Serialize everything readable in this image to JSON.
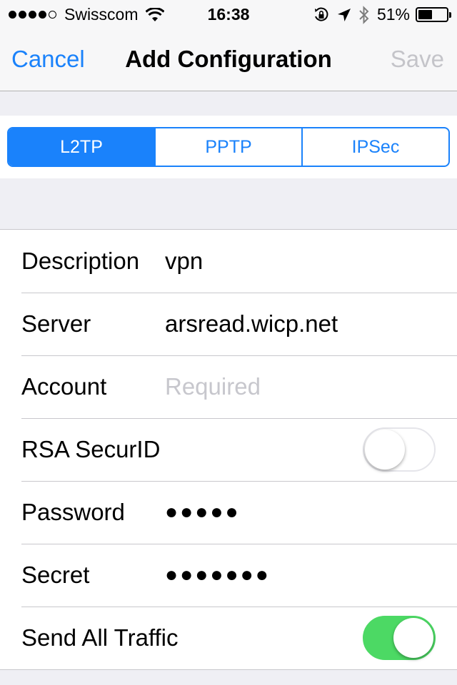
{
  "status_bar": {
    "carrier": "Swisscom",
    "signal_bars": 4,
    "signal_total": 5,
    "time": "16:38",
    "battery_percent": "51%",
    "battery_level": 0.51
  },
  "nav": {
    "cancel_label": "Cancel",
    "title": "Add Configuration",
    "save_label": "Save"
  },
  "segments": [
    {
      "label": "L2TP",
      "active": true
    },
    {
      "label": "PPTP",
      "active": false
    },
    {
      "label": "IPSec",
      "active": false
    }
  ],
  "form": {
    "description": {
      "label": "Description",
      "value": "vpn"
    },
    "server": {
      "label": "Server",
      "value": "arsread.wicp.net"
    },
    "account": {
      "label": "Account",
      "placeholder": "Required"
    },
    "rsa": {
      "label": "RSA SecurID",
      "on": false
    },
    "password": {
      "label": "Password",
      "value": "●●●●●"
    },
    "secret": {
      "label": "Secret",
      "value": "●●●●●●●"
    },
    "send_all_traffic": {
      "label": "Send All Traffic",
      "on": true
    }
  },
  "colors": {
    "accent": "#1a82fb",
    "toggle_on": "#4cd964",
    "disabled": "#c4c4c9",
    "placeholder": "#c7c7cd"
  }
}
